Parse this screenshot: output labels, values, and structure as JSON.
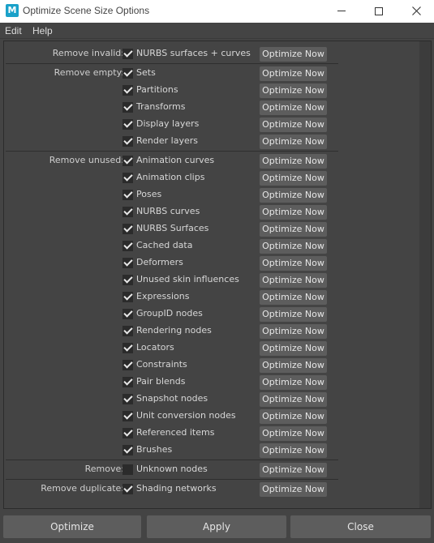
{
  "window": {
    "app_icon_letter": "M",
    "title": "Optimize Scene Size Options"
  },
  "menubar": {
    "items": [
      "Edit",
      "Help"
    ]
  },
  "optimize_label": "Optimize Now",
  "groups": [
    {
      "label": "Remove invalid:",
      "items": [
        {
          "label": "NURBS surfaces + curves",
          "checked": true
        }
      ]
    },
    {
      "label": "Remove empty:",
      "items": [
        {
          "label": "Sets",
          "checked": true
        },
        {
          "label": "Partitions",
          "checked": true
        },
        {
          "label": "Transforms",
          "checked": true
        },
        {
          "label": "Display layers",
          "checked": true
        },
        {
          "label": "Render layers",
          "checked": true
        }
      ]
    },
    {
      "label": "Remove unused:",
      "items": [
        {
          "label": "Animation curves",
          "checked": true
        },
        {
          "label": "Animation clips",
          "checked": true
        },
        {
          "label": "Poses",
          "checked": true
        },
        {
          "label": "NURBS curves",
          "checked": true
        },
        {
          "label": "NURBS Surfaces",
          "checked": true
        },
        {
          "label": "Cached data",
          "checked": true
        },
        {
          "label": "Deformers",
          "checked": true
        },
        {
          "label": "Unused skin influences",
          "checked": true
        },
        {
          "label": "Expressions",
          "checked": true
        },
        {
          "label": "GroupID nodes",
          "checked": true
        },
        {
          "label": "Rendering nodes",
          "checked": true
        },
        {
          "label": "Locators",
          "checked": true
        },
        {
          "label": "Constraints",
          "checked": true
        },
        {
          "label": "Pair blends",
          "checked": true
        },
        {
          "label": "Snapshot nodes",
          "checked": true
        },
        {
          "label": "Unit conversion nodes",
          "checked": true
        },
        {
          "label": "Referenced items",
          "checked": true
        },
        {
          "label": "Brushes",
          "checked": true
        }
      ]
    },
    {
      "label": "Remove:",
      "items": [
        {
          "label": "Unknown nodes",
          "checked": false
        }
      ]
    },
    {
      "label": "Remove duplicate:",
      "items": [
        {
          "label": "Shading networks",
          "checked": true
        }
      ]
    }
  ],
  "footer": {
    "optimize": "Optimize",
    "apply": "Apply",
    "close": "Close"
  }
}
